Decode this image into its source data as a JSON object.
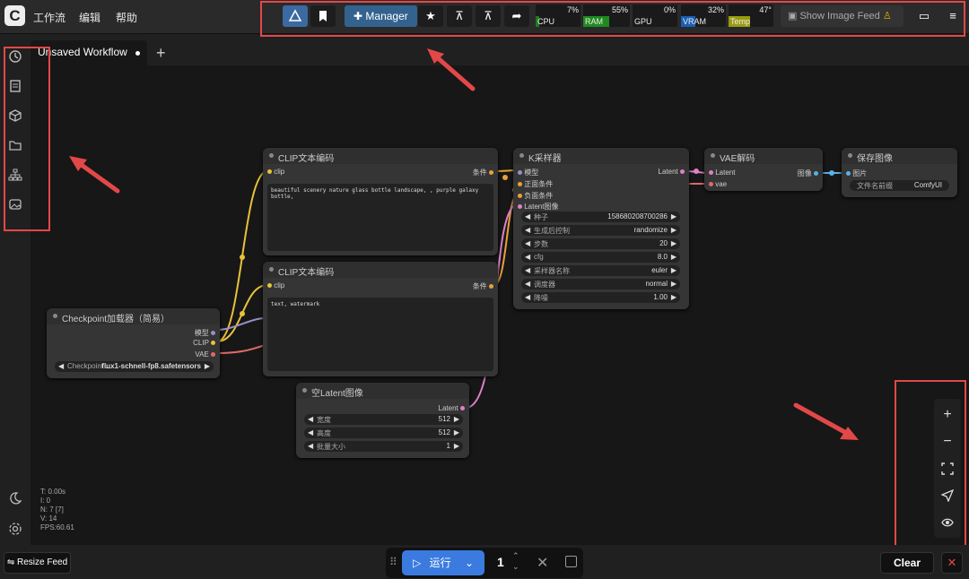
{
  "menu": {
    "logo": "C",
    "items": [
      "工作流",
      "编辑",
      "帮助"
    ]
  },
  "toolbar": {
    "manager_label": "Manager",
    "meters": [
      {
        "label": "CPU",
        "value": "7%",
        "fill_pct": 7,
        "color": "#1f7a1f"
      },
      {
        "label": "RAM",
        "value": "55%",
        "fill_pct": 55,
        "color": "#1f8a1f"
      },
      {
        "label": "GPU",
        "value": "0%",
        "fill_pct": 0,
        "color": "#1f7a1f"
      },
      {
        "label": "VRAM",
        "value": "32%",
        "fill_pct": 32,
        "color": "#1a5fb4"
      },
      {
        "label": "Temp",
        "value": "47°",
        "fill_pct": 47,
        "color": "#9a9a10"
      }
    ],
    "feed_label": "Show Image Feed"
  },
  "tabs": {
    "active": "Unsaved Workflow"
  },
  "nodes": {
    "clip1": {
      "title": "CLIP文本编码",
      "in": "clip",
      "out": "条件",
      "text": "beautiful scenery nature glass bottle landscape, , purple galaxy bottle,"
    },
    "clip2": {
      "title": "CLIP文本编码",
      "in": "clip",
      "out": "条件",
      "text": "text, watermark"
    },
    "ksampler": {
      "title": "K采样器",
      "inputs": [
        "模型",
        "正面条件",
        "负面条件",
        "Latent图像"
      ],
      "out": "Latent",
      "widgets": [
        {
          "label": "种子",
          "value": "158680208700286"
        },
        {
          "label": "生成后控制",
          "value": "randomize"
        },
        {
          "label": "步数",
          "value": "20"
        },
        {
          "label": "cfg",
          "value": "8.0"
        },
        {
          "label": "采样器名称",
          "value": "euler"
        },
        {
          "label": "调度器",
          "value": "normal"
        },
        {
          "label": "降噪",
          "value": "1.00"
        }
      ]
    },
    "vae": {
      "title": "VAE解码",
      "in1": "Latent",
      "in2": "vae",
      "out": "图像"
    },
    "save": {
      "title": "保存图像",
      "in": "图片",
      "widget_label": "文件名前缀",
      "widget_value": "ComfyUI"
    },
    "checkpoint": {
      "title": "Checkpoint加载器（简易）",
      "outs": [
        "模型",
        "CLIP",
        "VAE"
      ],
      "widget_label": "Checkpoint ...",
      "widget_value": "flux1-schnell-fp8.safetensors"
    },
    "latent": {
      "title": "空Latent图像",
      "out": "Latent",
      "widgets": [
        {
          "label": "宽度",
          "value": "512"
        },
        {
          "label": "高度",
          "value": "512"
        },
        {
          "label": "批量大小",
          "value": "1"
        }
      ]
    }
  },
  "stats": [
    "T: 0.00s",
    "I: 0",
    "N: 7 [7]",
    "V: 14",
    "FPS:60.61"
  ],
  "bottom": {
    "resize_feed": "Resize Feed",
    "run_label": "运行",
    "queue_count": "1",
    "clear": "Clear"
  }
}
